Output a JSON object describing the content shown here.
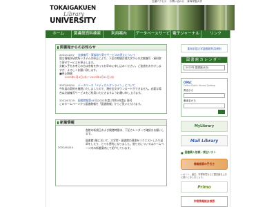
{
  "header": {
    "logo_line1": "TOKAIGAKUEN",
    "logo_line2": "Library",
    "logo_line3": "UNIVERSITY",
    "top_links": [
      "交通アクセス",
      "お問い合わせ",
      "東海学園大学"
    ]
  },
  "nav": {
    "items": [
      {
        "label": "ホーム",
        "width": 38
      },
      {
        "label": "図書館資料検索",
        "width": 46
      },
      {
        "label": "利用案内",
        "width": 46
      },
      {
        "label": "データベースサービス",
        "width": 52
      },
      {
        "label": "電子ジャーナル",
        "width": 44
      },
      {
        "label": "リンク",
        "width": 42
      }
    ]
  },
  "notices": {
    "title": "図書館からのお知らせ",
    "items": [
      {
        "date": "2022/12/07",
        "head": "文献複写・資料取り寄せサービスの停止について",
        "body": "国立情報学研究所システムの停止により、下記の期間は他大学からの文献複写・資料取り寄せサービスを停止します。",
        "body2": "文献入手をお考えの方は余裕を持ってお早めに申し込みください。ご迷惑をおかけしますが、よろしくお願い致します。",
        "period_label": "■停止期間",
        "period": "2023年1月4日(水)～2023年1月11日(水)"
      },
      {
        "date": "2022/09/30",
        "head": "データベース「メディカルオンライン」について",
        "body": "今年度の契約を継続いたしましたので、現在全文ダウンロードができません。必要な場合は文献複写サービスをご利用いただきますようお願い申し上げます。"
      },
      {
        "date": "2022/07/19",
        "head": "図書館報第44号",
        "head_suffix": "(2022年度 [令和4年度]) 発刊",
        "body": "このホームページから図書館報を「図書館報」からご覧いただけます。"
      }
    ]
  },
  "news": {
    "title": "新着情報",
    "items": [
      {
        "date": "",
        "text": "各館の新規日および開館時間は、下記カレンダーで確認をお願いします。"
      },
      {
        "date": "2022/04/14",
        "text": "図書館2階において、大学院・図書館の蔵書をリクエストしたり返却をしたり、とても便利になりました。借り方についてはホームページ内の新着案内にて紹介しています。"
      }
    ]
  },
  "right": {
    "link_top": "東海学園大学図書館利用規則",
    "calendar_title": "図書館カレンダー",
    "calendar_select": "2022年 図書館(4月)",
    "opac_title": "OPAC",
    "opac_sub": "Online Public Access Catalog",
    "opac_label1": "書名から",
    "opac_label2": "著者名から",
    "banner_mylib": "MyLibrary",
    "banner_mail": "Mail Library",
    "banner_request": "図書購入依頼・貸出リスト",
    "banner_search": "情報検索の手引き",
    "banner_search_note": "レポート、論文、卒業研究などに図書館を上手に使いこなしましょう。",
    "banner_primo": "Primo",
    "banner_gakujutsu": "学術情報総合検索"
  }
}
